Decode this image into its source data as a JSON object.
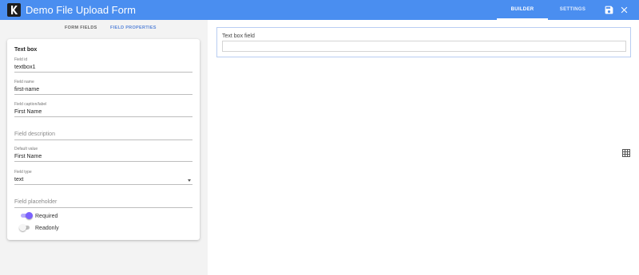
{
  "app": {
    "title": "Demo File Upload Form"
  },
  "top_nav": {
    "tabs": [
      {
        "label": "BUILDER",
        "active": true
      },
      {
        "label": "SETTINGS",
        "active": false
      }
    ],
    "icons": [
      "save-icon",
      "close-icon"
    ]
  },
  "sub_tabs": [
    {
      "label": "FORM FIELDS",
      "active": false
    },
    {
      "label": "FIELD PROPERTIES",
      "active": true
    }
  ],
  "properties": {
    "title": "Text box",
    "field_id": {
      "label": "Field id",
      "value": "textbox1"
    },
    "field_name": {
      "label": "Field name",
      "value": "first-name"
    },
    "field_caption": {
      "label": "Field caption/label",
      "value": "First Name"
    },
    "field_description": {
      "placeholder": "Field description"
    },
    "default_value": {
      "label": "Default value",
      "value": "First Name"
    },
    "field_type": {
      "label": "Field type",
      "value": "text"
    },
    "field_placeholder": {
      "placeholder": "Field placeholder"
    },
    "required": {
      "label": "Required",
      "on": true
    },
    "readonly": {
      "label": "Readonly",
      "on": false
    }
  },
  "preview": {
    "field_label": "Text box field",
    "input_value": ""
  },
  "icons": {
    "grid": "grid-icon"
  },
  "colors": {
    "header": "#4a8ef0",
    "accent": "#7b61ff",
    "active_subtab": "#5a86d8"
  }
}
